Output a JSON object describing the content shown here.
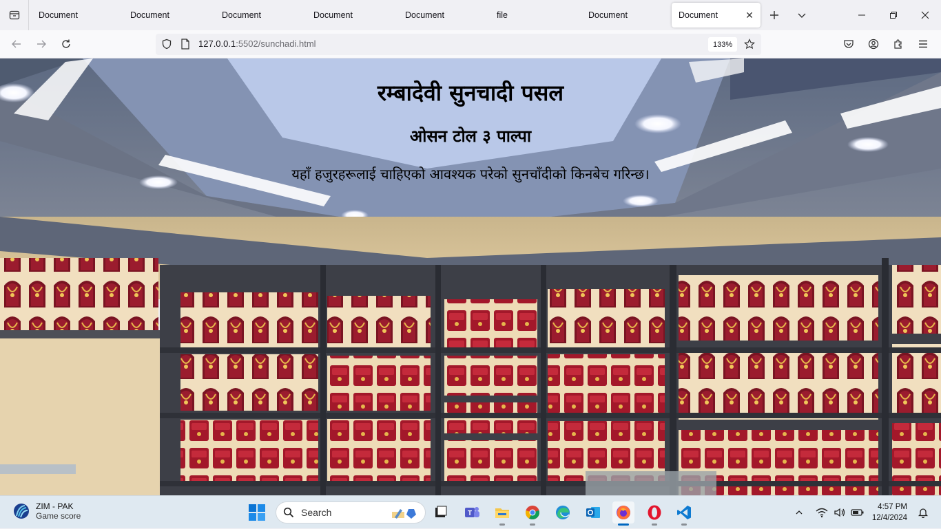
{
  "tabs": [
    {
      "label": "Document"
    },
    {
      "label": "Document"
    },
    {
      "label": "Document"
    },
    {
      "label": "Document"
    },
    {
      "label": "Document"
    },
    {
      "label": "file"
    },
    {
      "label": "Document"
    },
    {
      "label": "Document",
      "active": true
    }
  ],
  "navbar": {
    "url_host": "127.0.0.1",
    "url_path": ":5502/sunchadi.html",
    "zoom": "133%"
  },
  "page": {
    "title": "रम्बादेवी सुनचादी पसल",
    "subtitle": "ओसन टोल ३ पाल्पा",
    "description": "यहाँ हजुरहरूलाई चाहिएको आवश्यक परेको सुनचाँदीको किनबेच गरिन्छ।"
  },
  "taskbar": {
    "widget_title": "ZIM - PAK",
    "widget_subtitle": "Game score",
    "search_label": "Search",
    "time": "4:57 PM",
    "date": "12/4/2024"
  },
  "colors": {
    "accent": "#0067c0",
    "chrome_bg": "#f0f0f4"
  }
}
